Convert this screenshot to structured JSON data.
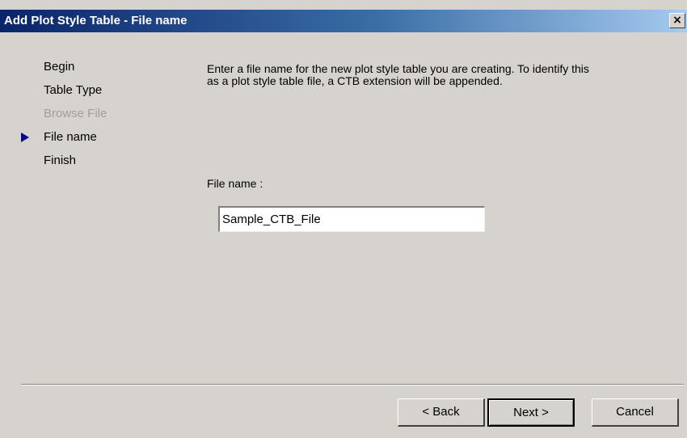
{
  "window": {
    "title": "Add Plot Style Table - File name",
    "close_glyph": "×"
  },
  "steps": [
    {
      "label": "Begin",
      "state": "done"
    },
    {
      "label": "Table Type",
      "state": "done"
    },
    {
      "label": "Browse File",
      "state": "disabled"
    },
    {
      "label": "File name",
      "state": "current"
    },
    {
      "label": "Finish",
      "state": "pending"
    }
  ],
  "main": {
    "description": "Enter a file name for the new plot style table you are creating. To identify this as a plot style table file, a CTB extension will be appended.",
    "file_name_label": "File name :",
    "file_name_value": "Sample_CTB_File"
  },
  "buttons": {
    "back": "< Back",
    "next": "Next >",
    "cancel": "Cancel"
  },
  "colors": {
    "title_gradient_start": "#0a246a",
    "title_gradient_end": "#a6caf0",
    "dialog_bg": "#d6d3ce",
    "current_step_arrow": "#0a0a80",
    "disabled_text": "#a09f9a"
  }
}
